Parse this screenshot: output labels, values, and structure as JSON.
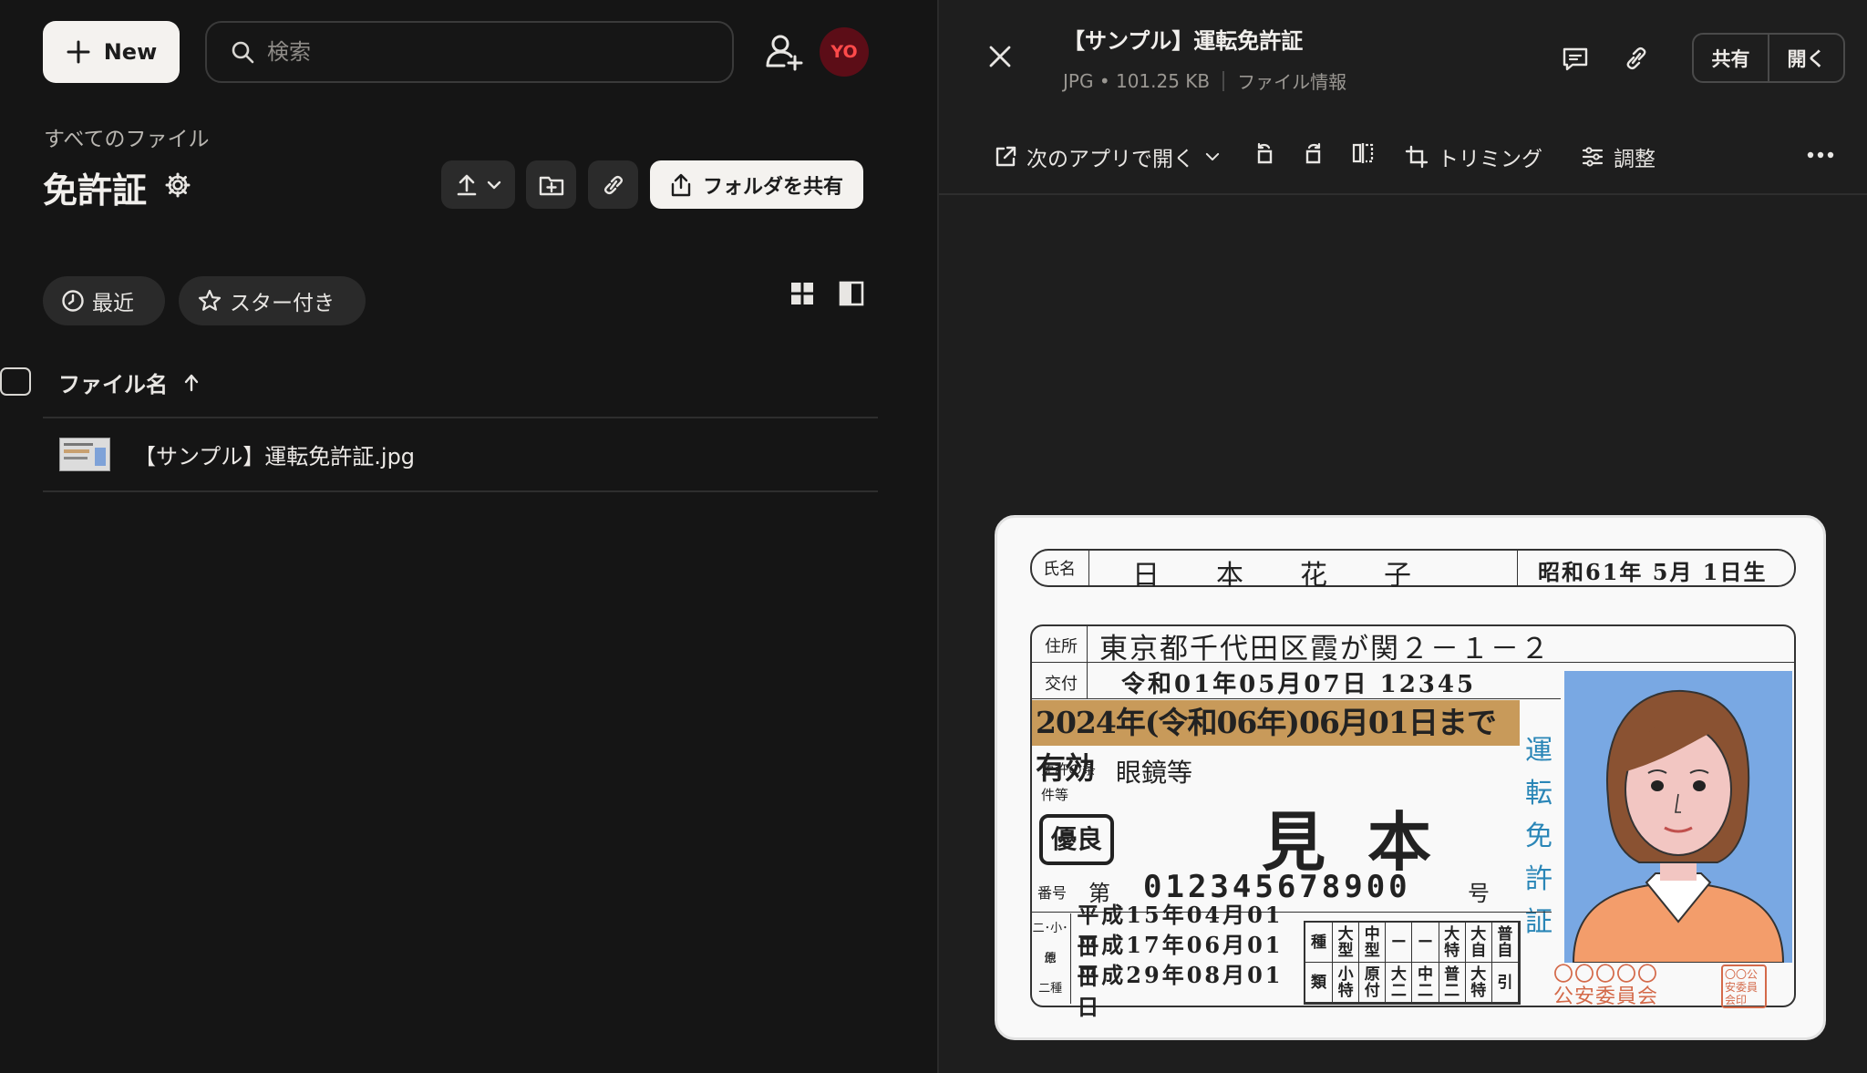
{
  "left_pane": {
    "new_button": {
      "label": "New"
    },
    "search": {
      "placeholder": "検索"
    },
    "avatar": {
      "initials": "YO",
      "color": "#5c0d17"
    },
    "breadcrumb": "すべてのファイル",
    "page_title": "免許証",
    "share_folder_button": "フォルダを共有",
    "chips": {
      "recent": "最近",
      "starred": "スター付き"
    },
    "table": {
      "column_header": "ファイル名",
      "rows": [
        {
          "name": "【サンプル】運転免許証.jpg"
        }
      ]
    }
  },
  "preview": {
    "title": "【サンプル】運転免許証",
    "meta": "JPG • 101.25 KB",
    "file_info": "ファイル情報",
    "share_button": "共有",
    "open_button": "開く",
    "toolbar": {
      "open_with": "次のアプリで開く",
      "trim": "トリミング",
      "adjust": "調整"
    },
    "license": {
      "name_label": "氏名",
      "name": "日本花子",
      "dob": "昭和61年 5月 1日生",
      "address_label": "住所",
      "address": "東京都千代田区霞が関２－１－２",
      "issue_label": "交付",
      "issue": "令和01年05月07日 12345",
      "expiry": "2024年(令和06年)06月01日まで有効",
      "cond_label": "免許の条件等",
      "cond": "眼鏡等",
      "yuryo": "優良",
      "mihon": "見本",
      "vertical": "運転免許証",
      "num_label": "番号",
      "num_prefix": "第",
      "number": "012345678900",
      "num_suffix": "号",
      "dates": [
        {
          "key": "二･小･原",
          "date": "平成15年04月01日"
        },
        {
          "key": "他",
          "date": "平成17年06月01日"
        },
        {
          "key": "二種",
          "date": "平成29年08月01日"
        }
      ],
      "class_grid": [
        "種",
        "大型",
        "中型",
        "ー",
        "ー",
        "大特",
        "大自",
        "普自",
        "類",
        "小特",
        "原付",
        "大二",
        "中二",
        "普二",
        "大特",
        "引"
      ],
      "seal": "〇〇〇〇〇\n公安委員会",
      "stamp": "〇〇公安委員会印"
    }
  }
}
